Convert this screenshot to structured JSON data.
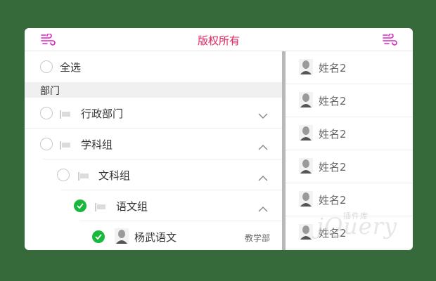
{
  "header": {
    "title": "版权所有",
    "left_icon": "wind-icon",
    "right_icon": "wind-icon",
    "icon_color": "#e020c8"
  },
  "select_all": {
    "label": "全选",
    "checked": false
  },
  "section": {
    "label": "部门"
  },
  "tree": [
    {
      "label": "行政部门",
      "checked": false,
      "expanded": false
    },
    {
      "label": "学科组",
      "checked": false,
      "expanded": true
    },
    {
      "label": "文科组",
      "checked": false,
      "expanded": true
    },
    {
      "label": "语文组",
      "checked": true,
      "expanded": true
    }
  ],
  "member": {
    "name": "杨武语文",
    "dept": "教学部",
    "checked": true
  },
  "people": [
    "姓名2",
    "姓名2",
    "姓名2",
    "姓名2",
    "姓名2",
    "姓名2"
  ],
  "watermark": {
    "text": "jQuery",
    "sub": "插件库"
  },
  "colors": {
    "background": "#366a3b",
    "accent_red": "#e0245e",
    "check_green": "#18b83c"
  }
}
